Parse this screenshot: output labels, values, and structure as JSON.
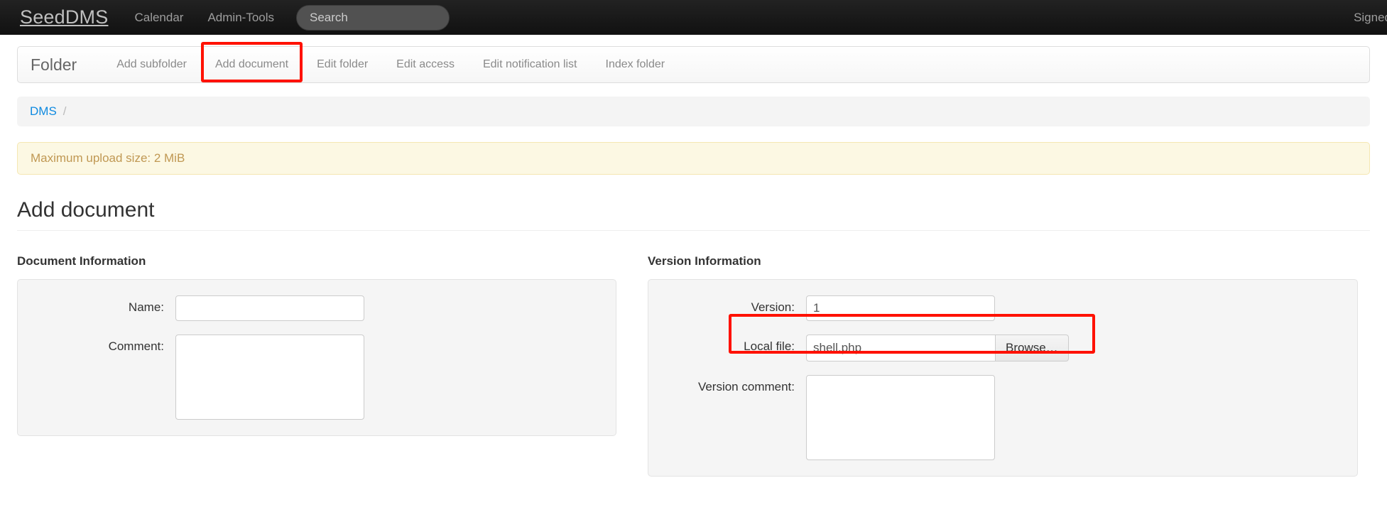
{
  "navbar": {
    "brand": "SeedDMS",
    "links": [
      {
        "label": "Calendar"
      },
      {
        "label": "Admin-Tools"
      }
    ],
    "search_placeholder": "Search",
    "search_value": "",
    "right_text": "Signed"
  },
  "tabbar": {
    "title": "Folder",
    "tabs": [
      {
        "label": "Add subfolder"
      },
      {
        "label": "Add document"
      },
      {
        "label": "Edit folder"
      },
      {
        "label": "Edit access"
      },
      {
        "label": "Edit notification list"
      },
      {
        "label": "Index folder"
      }
    ]
  },
  "breadcrumb": {
    "root": "DMS",
    "separator": "/"
  },
  "alert": {
    "text": "Maximum upload size: 2 MiB"
  },
  "page": {
    "title": "Add document"
  },
  "document_information": {
    "section_title": "Document Information",
    "name_label": "Name:",
    "name_value": "",
    "comment_label": "Comment:",
    "comment_value": ""
  },
  "version_information": {
    "section_title": "Version Information",
    "version_label": "Version:",
    "version_value": "1",
    "local_file_label": "Local file:",
    "local_file_value": "shell.php",
    "browse_label": "Browse…",
    "version_comment_label": "Version comment:",
    "version_comment_value": ""
  },
  "annotations": {
    "highlight_color": "#ff1100",
    "boxes": [
      {
        "target": "Add document tab"
      },
      {
        "target": "Local file row"
      }
    ]
  },
  "colors": {
    "navbar_bg": "#111111",
    "link_blue": "#0f8ae0",
    "alert_bg": "#fcf8e3",
    "alert_text": "#c09853",
    "well_bg": "#f5f5f5"
  }
}
